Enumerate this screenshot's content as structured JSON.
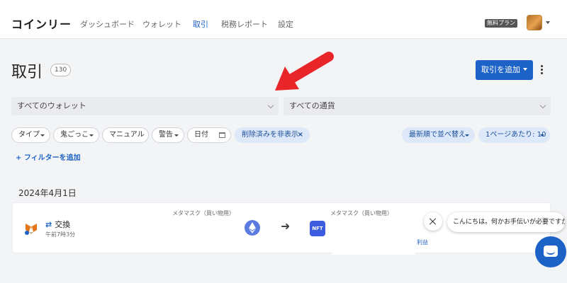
{
  "header": {
    "logo": "コインリー",
    "nav": [
      "ダッシュボード",
      "ウォレット",
      "取引",
      "税務レポート",
      "設定"
    ],
    "active_nav": "取引",
    "plan_badge": "無料プラン",
    "avatar_icon": "fox-avatar-icon"
  },
  "page": {
    "title": "取引",
    "count": "130",
    "add_button": "取引を追加",
    "more_icon": "kebab-icon",
    "annotation_icon": "red-arrow-icon"
  },
  "filters": {
    "wallet_select": "すべてのウォレット",
    "currency_select": "すべての通貨",
    "chips": {
      "type": "タイプ",
      "tag": "鬼ごっこ",
      "manual": "マニュアル",
      "warning": "警告",
      "date": "日付",
      "hide_deleted": "削除済みを非表示"
    },
    "sort": "最新順で並べ替え",
    "per_page": "1ページあたり: 10",
    "add_filter": "+ フィルターを追加"
  },
  "transactions": {
    "date_heading": "2024年4月1日",
    "items": [
      {
        "type_icon": "swap-icon",
        "type": "交換",
        "time": "午前7時3分",
        "from_wallet": "メタマスク（買い物用）",
        "to_wallet": "メタマスク（買い物用）",
        "from_asset_icon": "ethereum-icon",
        "to_asset_label": "NFT",
        "gain_label": "利益"
      }
    ]
  },
  "chat": {
    "greeting": "こんにちは。何かお手伝いが必要ですか?"
  },
  "colors": {
    "accent": "#1d63c7",
    "annotation": "#e8262a"
  }
}
